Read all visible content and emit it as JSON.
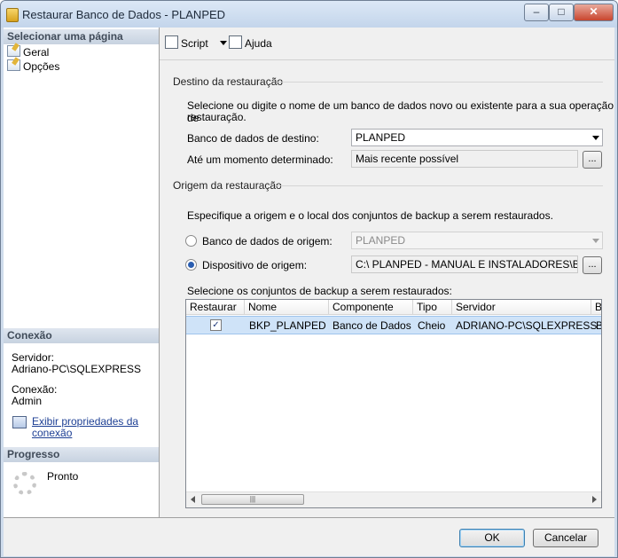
{
  "window": {
    "title": "Restaurar Banco de Dados - PLANPED",
    "minimize": "–",
    "maximize": "□",
    "close": "✕"
  },
  "left": {
    "pages_header": "Selecionar uma página",
    "pages": [
      {
        "label": "Geral",
        "icon": "page-icon"
      },
      {
        "label": "Opções",
        "icon": "page-icon"
      }
    ],
    "connection_header": "Conexão",
    "server_label": "Servidor:",
    "server_value": "Adriano-PC\\SQLEXPRESS",
    "connection_label": "Conexão:",
    "connection_value": "Admin",
    "view_props_line1": "Exibir propriedades da",
    "view_props_line2": "conexão",
    "progress_header": "Progresso",
    "progress_status": "Pronto"
  },
  "toolbar": {
    "script_label": "Script",
    "help_label": "Ajuda"
  },
  "destination": {
    "group_title": "Destino da restauração",
    "instructions_line1": "Selecione ou digite o nome de um banco de dados novo ou existente para a sua operação de",
    "instructions_line2": "restauração.",
    "db_label": "Banco de dados de destino:",
    "db_value": "PLANPED",
    "time_label": "Até um momento determinado:",
    "time_value": "Mais recente possível",
    "time_button": "..."
  },
  "source": {
    "group_title": "Origem da restauração",
    "instructions": "Especifique a origem e o local dos conjuntos de backup a serem restaurados.",
    "from_db_label": "Banco de dados de origem:",
    "from_db_value": "PLANPED",
    "from_device_label": "Dispositivo de origem:",
    "from_device_value": "C:\\  PLANPED - MANUAL E INSTALADORES\\BANCO",
    "device_button": "...",
    "selected_option": "from_device",
    "sets_label": "Selecione os conjuntos de backup a serem restaurados:"
  },
  "backup_grid": {
    "columns": [
      "Restaurar",
      "Nome",
      "Componente",
      "Tipo",
      "Servidor",
      "Ba"
    ],
    "rows": [
      {
        "restore": true,
        "restore_mark": "✓",
        "name": "BKP_PLANPED",
        "component": "Banco de Dados",
        "type": "Cheio",
        "server": "ADRIANO-PC\\SQLEXPRESS",
        "extra": "B"
      }
    ],
    "scroll_grip": "|||"
  },
  "buttons": {
    "ok": "OK",
    "cancel": "Cancelar"
  }
}
